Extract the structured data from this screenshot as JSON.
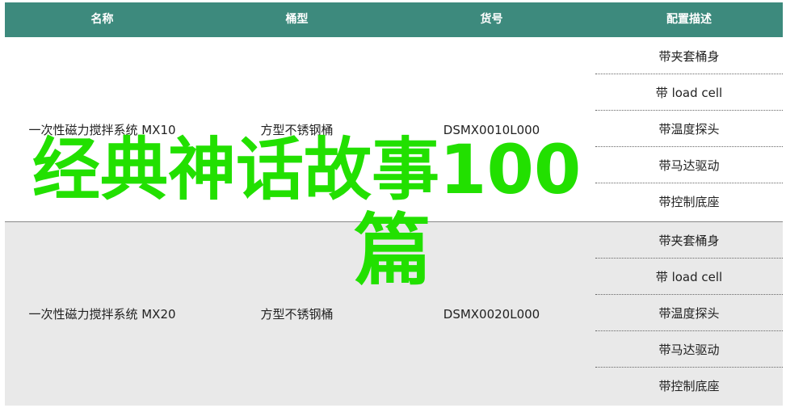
{
  "columns": [
    "名称",
    "桶型",
    "货号",
    "配置描述"
  ],
  "products": [
    {
      "name": "一次性磁力搅拌系统 MX10",
      "bucket": "方型不锈钢桶",
      "sku": "DSMX0010L000",
      "configs": [
        "带夹套桶身",
        "带 load cell",
        "带温度探头",
        "带马达驱动",
        "带控制底座"
      ]
    },
    {
      "name": "一次性磁力搅拌系统 MX20",
      "bucket": "方型不锈钢桶",
      "sku": "DSMX0020L000",
      "configs": [
        "带夹套桶身",
        "带 load cell",
        "带温度探头",
        "带马达驱动",
        "带控制底座"
      ]
    }
  ],
  "overlay": {
    "line1": "经典神话故事100",
    "line2": "篇"
  },
  "colors": {
    "header_bg": "#3d8a7d",
    "overlay_text": "#22e000",
    "alt_row_bg": "#e9e9e9"
  }
}
